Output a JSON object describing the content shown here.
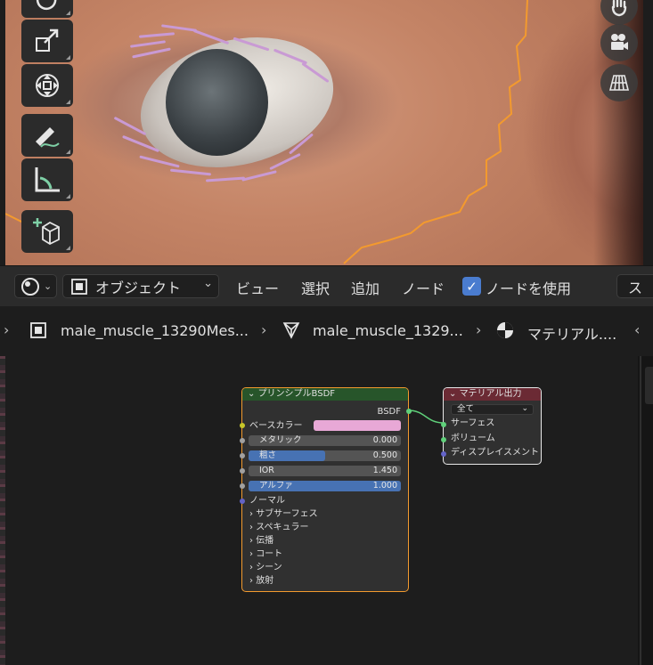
{
  "header": {
    "mode_dropdown": "オブジェクト",
    "menus": [
      "ビュー",
      "選択",
      "追加",
      "ノード"
    ],
    "use_nodes_label": "ノードを使用",
    "use_nodes_checked": true,
    "slot_button": "ス"
  },
  "breadcrumb": {
    "object": "male_muscle_13290Mes...",
    "mesh": "male_muscle_1329...",
    "material": "マテリアル...."
  },
  "bsdf_node": {
    "title": "プリンシプルBSDF",
    "output": "BSDF",
    "base_color_label": "ベースカラー",
    "base_color_value": "#e8a8d6",
    "metallic_label": "メタリック",
    "metallic_value": "0.000",
    "roughness_label": "粗さ",
    "roughness_value": "0.500",
    "ior_label": "IOR",
    "ior_value": "1.450",
    "alpha_label": "アルファ",
    "alpha_value": "1.000",
    "normal_label": "ノーマル",
    "panels": [
      "サブサーフェス",
      "スペキュラー",
      "伝播",
      "コート",
      "シーン",
      "放射"
    ]
  },
  "output_node": {
    "title": "マテリアル出力",
    "target": "全て",
    "inputs": [
      "サーフェス",
      "ボリューム",
      "ディスプレイスメント"
    ]
  },
  "colors": {
    "bsdf_header": "#27552a",
    "output_header": "#6b2a34",
    "selected_outline": "#f39a2e",
    "shader_socket": "#5fd07a",
    "color_socket": "#c7c729",
    "float_socket": "#a1a1a1",
    "vector_socket": "#6363c7"
  }
}
